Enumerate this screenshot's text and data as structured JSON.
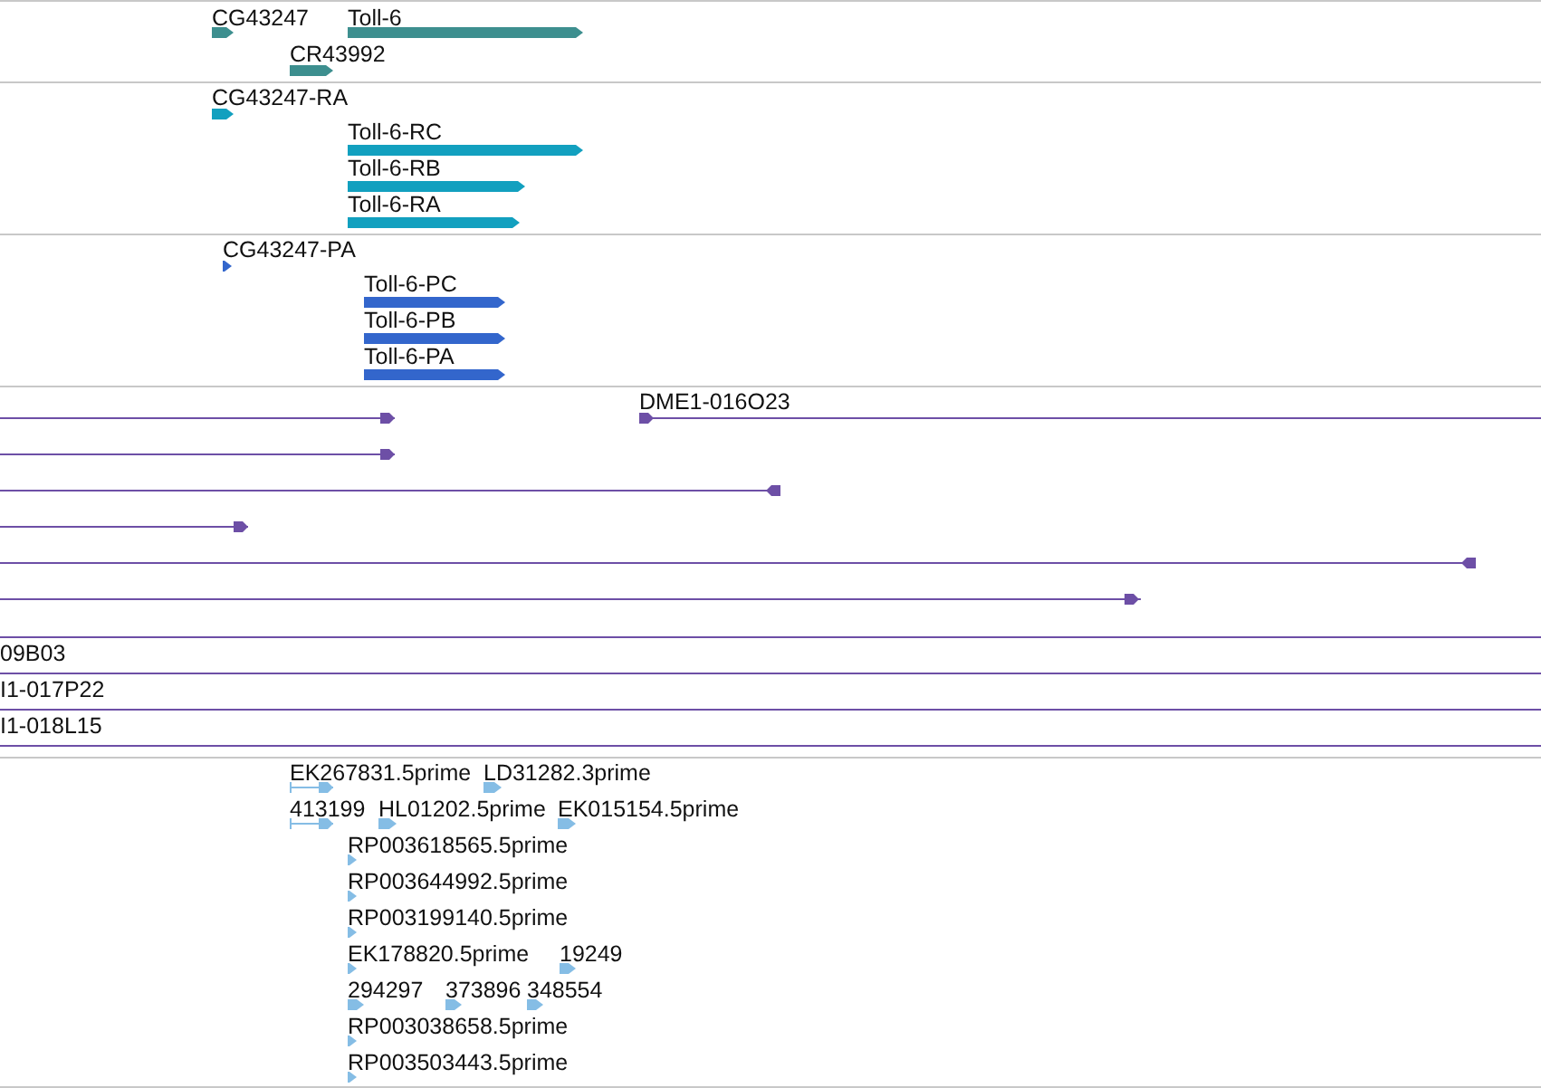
{
  "tracks": [
    {
      "kind": "gene",
      "color": "#3d8f8f",
      "features": [
        {
          "label": "CG43247",
          "reverse": false
        },
        {
          "label": "Toll-6",
          "reverse": false
        },
        {
          "label": "CR43992",
          "reverse": false
        }
      ]
    },
    {
      "kind": "transcript",
      "color": "#12a0bf",
      "features": [
        {
          "label": "CG43247-RA",
          "reverse": false
        },
        {
          "label": "Toll-6-RC",
          "reverse": false
        },
        {
          "label": "Toll-6-RB",
          "reverse": false
        },
        {
          "label": "Toll-6-RA",
          "reverse": false
        }
      ]
    },
    {
      "kind": "protein",
      "color": "#3366cc",
      "features": [
        {
          "label": "CG43247-PA",
          "reverse": false
        },
        {
          "label": "Toll-6-PC",
          "reverse": false
        },
        {
          "label": "Toll-6-PB",
          "reverse": false
        },
        {
          "label": "Toll-6-PA",
          "reverse": false
        }
      ]
    },
    {
      "kind": "clone",
      "color": "#6d4fa6",
      "features": [
        {
          "arrow": true,
          "reverse": false
        },
        {
          "label": "DME1-016O23",
          "arrow": true,
          "reverse": false
        },
        {
          "arrow": true,
          "reverse": false
        },
        {
          "arrow": true,
          "reverse": true
        },
        {
          "arrow": true,
          "reverse": false
        },
        {
          "arrow": true,
          "reverse": true
        },
        {
          "arrow": true,
          "reverse": false
        },
        {
          "arrow": false
        },
        {
          "label": "09B03",
          "arrow": false
        },
        {
          "label": "I1-017P22",
          "arrow": false
        },
        {
          "label": "I1-018L15",
          "arrow": false
        }
      ]
    },
    {
      "kind": "est",
      "color": "#85bde5",
      "features": [
        {
          "label": "EK267831.5prime",
          "reverse": false
        },
        {
          "label": "LD31282.3prime",
          "reverse": false
        },
        {
          "label": "413199",
          "reverse": false
        },
        {
          "label": "HL01202.5prime",
          "reverse": false
        },
        {
          "label": "EK015154.5prime",
          "reverse": false
        },
        {
          "label": "RP003618565.5prime",
          "reverse": false
        },
        {
          "label": "RP003644992.5prime",
          "reverse": false
        },
        {
          "label": "RP003199140.5prime",
          "reverse": false
        },
        {
          "label": "EK178820.5prime",
          "reverse": false
        },
        {
          "label": "19249",
          "reverse": false
        },
        {
          "label": "294297",
          "reverse": false
        },
        {
          "label": "373896",
          "reverse": false
        },
        {
          "label": "348554",
          "reverse": false
        },
        {
          "label": "RP003038658.5prime",
          "reverse": false
        },
        {
          "label": "RP003503443.5prime",
          "reverse": false
        }
      ]
    }
  ]
}
